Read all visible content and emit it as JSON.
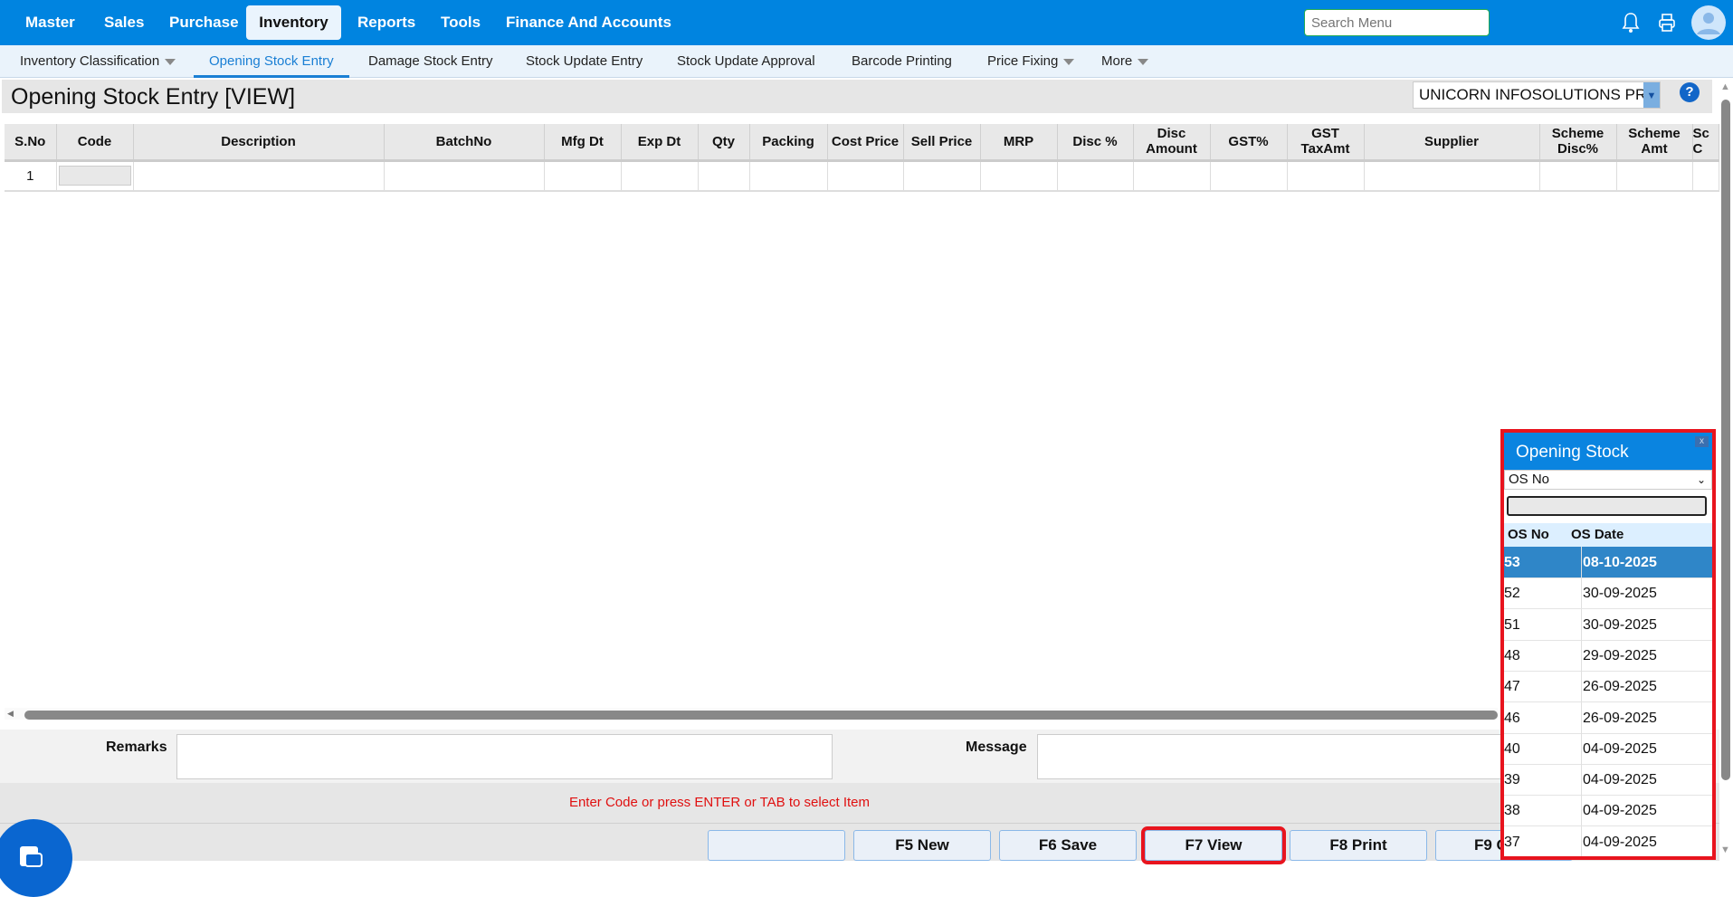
{
  "topnav": {
    "items": [
      "Master",
      "Sales",
      "Purchase",
      "Inventory",
      "Reports",
      "Tools",
      "Finance And Accounts"
    ],
    "active": "Inventory",
    "search_placeholder": "Search Menu"
  },
  "subnav": {
    "items": [
      "Inventory Classification",
      "Opening Stock Entry",
      "Damage Stock Entry",
      "Stock Update Entry",
      "Stock Update Approval",
      "Barcode Printing",
      "Price Fixing",
      "More"
    ],
    "active": "Opening Stock Entry"
  },
  "page": {
    "title": "Opening Stock Entry [VIEW]",
    "company": "UNICORN INFOSOLUTIONS PR",
    "help": "?"
  },
  "grid": {
    "columns": [
      "S.No",
      "Code",
      "Description",
      "BatchNo",
      "Mfg Dt",
      "Exp Dt",
      "Qty",
      "Packing",
      "Cost Price",
      "Sell Price",
      "MRP",
      "Disc %",
      "Disc Amount",
      "GST%",
      "GST TaxAmt",
      "Supplier",
      "Scheme Disc%",
      "Scheme Amt",
      "Sc C"
    ],
    "rows": [
      {
        "sno": "1"
      }
    ]
  },
  "footer": {
    "remarks_label": "Remarks",
    "message_label": "Message",
    "status_message": "Enter Code or press ENTER or TAB to select Item",
    "buttons": [
      "",
      "F5 New",
      "F6 Save",
      "F7 View",
      "F8 Print",
      "F9 C"
    ]
  },
  "popup": {
    "title": "Opening Stock",
    "close": "x",
    "filter": "OS No",
    "headers": [
      "OS No",
      "OS Date"
    ],
    "rows": [
      [
        "53",
        "08-10-2025"
      ],
      [
        "52",
        "30-09-2025"
      ],
      [
        "51",
        "30-09-2025"
      ],
      [
        "48",
        "29-09-2025"
      ],
      [
        "47",
        "26-09-2025"
      ],
      [
        "46",
        "26-09-2025"
      ],
      [
        "40",
        "04-09-2025"
      ],
      [
        "39",
        "04-09-2025"
      ],
      [
        "38",
        "04-09-2025"
      ],
      [
        "37",
        "04-09-2025"
      ]
    ]
  },
  "colors": {
    "brand": "#0084e0",
    "highlight": "#e8141e",
    "status": "#e01010"
  }
}
